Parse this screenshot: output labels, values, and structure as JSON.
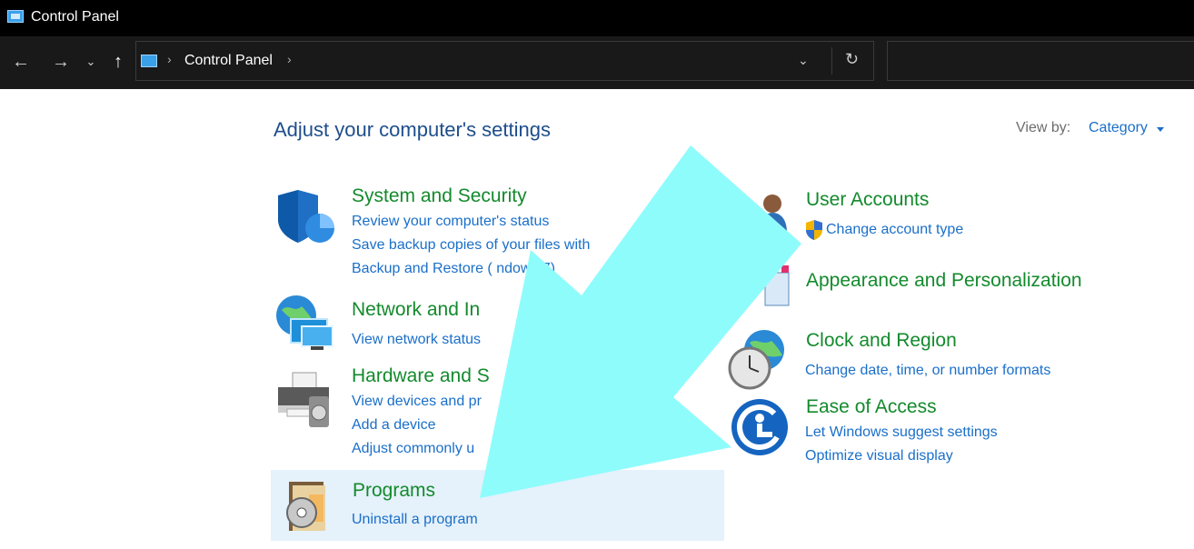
{
  "window": {
    "title": "Control Panel",
    "icon": "control-panel-icon"
  },
  "nav": {
    "back": "←",
    "forward": "→",
    "recent": "⌄",
    "up": "↑",
    "breadcrumb": "Control Panel",
    "refresh": "↻"
  },
  "header": {
    "title": "Adjust your computer's settings",
    "view_by_label": "View by:",
    "view_by_value": "Category"
  },
  "left_categories": [
    {
      "title": "System and Security",
      "icon": "shield-icon",
      "links": [
        "Review your computer's status",
        "Save backup copies of your files with",
        "Backup and Restore (  ndows 7)"
      ]
    },
    {
      "title": "Network and In",
      "icon": "network-globe-icon",
      "links": [
        "View network status"
      ]
    },
    {
      "title": "Hardware and S",
      "icon": "printer-icon",
      "links": [
        "View devices and pr",
        "Add a device",
        "Adjust commonly u"
      ]
    },
    {
      "title": "Programs",
      "icon": "programs-disc-icon",
      "links": [
        "Uninstall a program"
      ]
    }
  ],
  "right_categories": [
    {
      "title": "User Accounts",
      "icon": "users-icon",
      "links": [
        "Change account type"
      ]
    },
    {
      "title": "Appearance and Personalization",
      "icon": "monitor-paint-icon",
      "links": []
    },
    {
      "title": "Clock and Region",
      "icon": "clock-globe-icon",
      "links": [
        "Change date, time, or number formats"
      ]
    },
    {
      "title": "Ease of Access",
      "icon": "ease-of-access-icon",
      "links": [
        "Let Windows suggest settings",
        "Optimize visual display"
      ]
    }
  ],
  "colors": {
    "category_title": "#138a2c",
    "link": "#1a6fc9",
    "header": "#1e4e8c",
    "highlight": "#e5f1fb",
    "overlay_arrow": "#8ffcfc"
  }
}
